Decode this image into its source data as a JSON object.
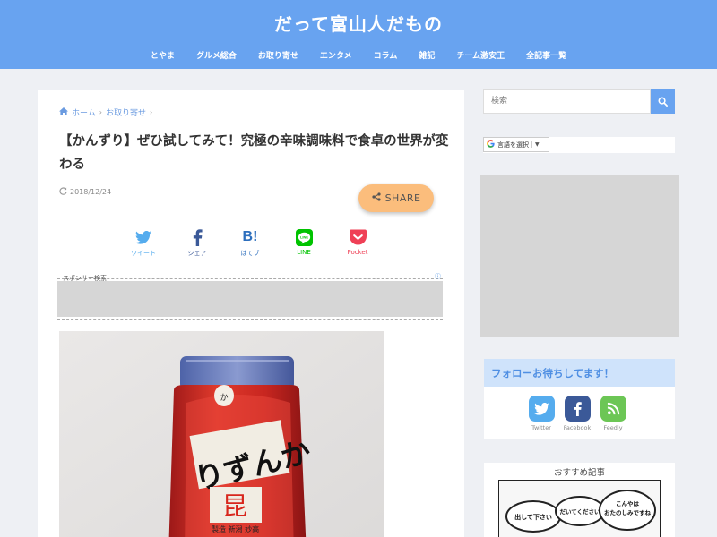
{
  "header": {
    "site_title": "だって富山人だもの",
    "nav": [
      "とやま",
      "グルメ総合",
      "お取り寄せ",
      "エンタメ",
      "コラム",
      "雑記",
      "チーム激安王",
      "全記事一覧"
    ]
  },
  "article": {
    "breadcrumb": [
      "ホーム",
      "お取り寄せ"
    ],
    "title": "【かんずり】ぜひ試してみて！究極の辛味調味料で食卓の世界が変わる",
    "date": "2018/12/24",
    "share_label": "SHARE",
    "sns": [
      {
        "label": "ツイート",
        "icon": "twitter-icon",
        "color": "#55acee"
      },
      {
        "label": "シェア",
        "icon": "facebook-icon",
        "color": "#3b5998"
      },
      {
        "label": "はてブ",
        "icon": "hatena-icon",
        "color": "#2c6ebd"
      },
      {
        "label": "LINE",
        "icon": "line-icon",
        "color": "#00c300"
      },
      {
        "label": "Pocket",
        "icon": "pocket-icon",
        "color": "#ef4056"
      }
    ],
    "ad_label": "スポンサー検索",
    "photo": {
      "bottle_script": "かんずり",
      "bottle_sub": "製造 新潟 妙高"
    }
  },
  "sidebar": {
    "search_placeholder": "検索",
    "translate_label": "言語を選択",
    "follow_heading": "フォローお待ちしてます！",
    "follow": [
      {
        "label": "Twitter",
        "icon": "twitter-icon",
        "color": "#55acee"
      },
      {
        "label": "Facebook",
        "icon": "facebook-icon",
        "color": "#3b5998"
      },
      {
        "label": "Feedly",
        "icon": "feedly-icon",
        "color": "#6cc655"
      }
    ],
    "recommend_heading": "おすすめ記事",
    "recommend_bubbles": [
      "出して下さい",
      "だいてください",
      "こんやは\nおたのしみですね"
    ]
  },
  "colors": {
    "header_bg": "#68a3f0",
    "accent": "#68a3f0",
    "share_button": "#fbbd7c",
    "follow_head_bg": "#cfe3fb"
  }
}
